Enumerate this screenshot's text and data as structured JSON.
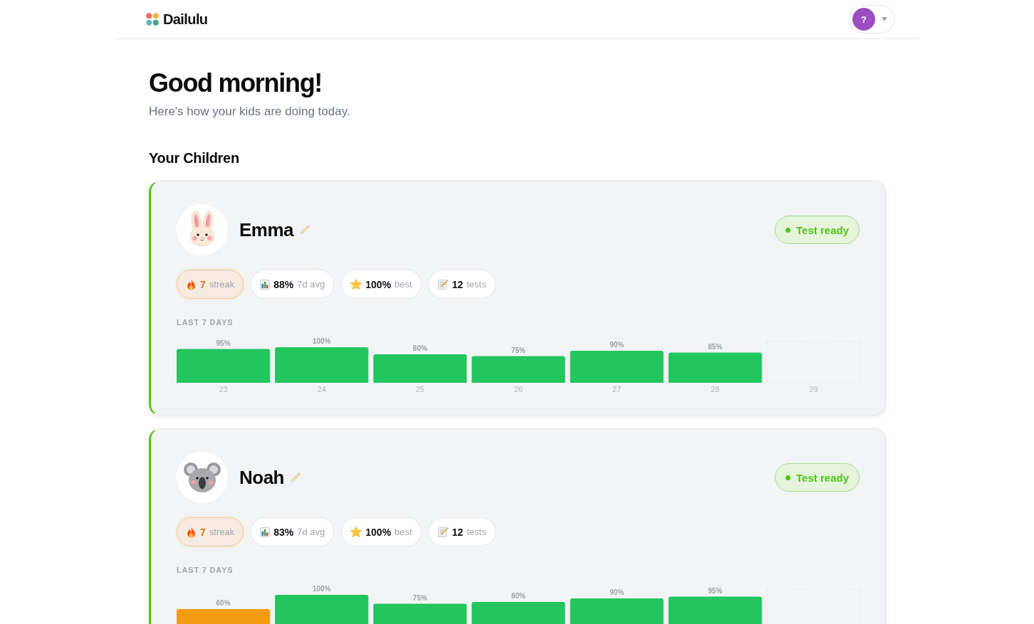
{
  "header": {
    "app_name": "Dailulu",
    "account": {
      "avatar_text": "?"
    }
  },
  "greeting": {
    "title": "Good morning!",
    "subtitle": "Here's how your kids are doing today."
  },
  "section_title": "Your Children",
  "children": [
    {
      "name": "Emma",
      "avatar": {
        "kind": "rabbit"
      },
      "status": {
        "label": "Test ready"
      },
      "stats": [
        {
          "kind": "streak",
          "value": "7",
          "label": "streak"
        },
        {
          "kind": "average",
          "value": "88%",
          "label": "7d avg"
        },
        {
          "kind": "best",
          "value": "100%",
          "label": "best"
        },
        {
          "kind": "tests",
          "value": "12",
          "label": "tests"
        }
      ],
      "chart_data": {
        "type": "bar",
        "title": "LAST 7 DAYS",
        "categories": [
          "23",
          "24",
          "25",
          "26",
          "27",
          "28",
          "29"
        ],
        "series": [
          {
            "color": "#22c55e",
            "values": [
              95,
              100,
              80,
              75,
              90,
              85,
              null
            ],
            "value_labels": [
              "95%",
              "100%",
              "80%",
              "75%",
              "90%",
              "85%",
              null
            ]
          }
        ]
      }
    },
    {
      "name": "Noah",
      "avatar": {
        "kind": "koala"
      },
      "status": {
        "label": "Test ready"
      },
      "stats": [
        {
          "kind": "streak",
          "value": "7",
          "label": "streak"
        },
        {
          "kind": "average",
          "value": "83%",
          "label": "7d avg"
        },
        {
          "kind": "best",
          "value": "100%",
          "label": "best"
        },
        {
          "kind": "tests",
          "value": "12",
          "label": "tests"
        }
      ],
      "chart_data": {
        "type": "bar",
        "title": "LAST 7 DAYS",
        "stacked": true,
        "series": [
          {
            "color": "#f39c12",
            "values": [
              60,
              null,
              null,
              null,
              null,
              null,
              null
            ],
            "value_labels": [
              "60%",
              null,
              null,
              null,
              null,
              null,
              null
            ]
          },
          {
            "color": "#22c55e",
            "values": [
              null,
              100,
              75,
              80,
              90,
              95,
              null
            ],
            "value_labels": [
              null,
              "100%",
              "75%",
              "80%",
              "90%",
              "95%",
              null
            ]
          }
        ]
      }
    }
  ]
}
